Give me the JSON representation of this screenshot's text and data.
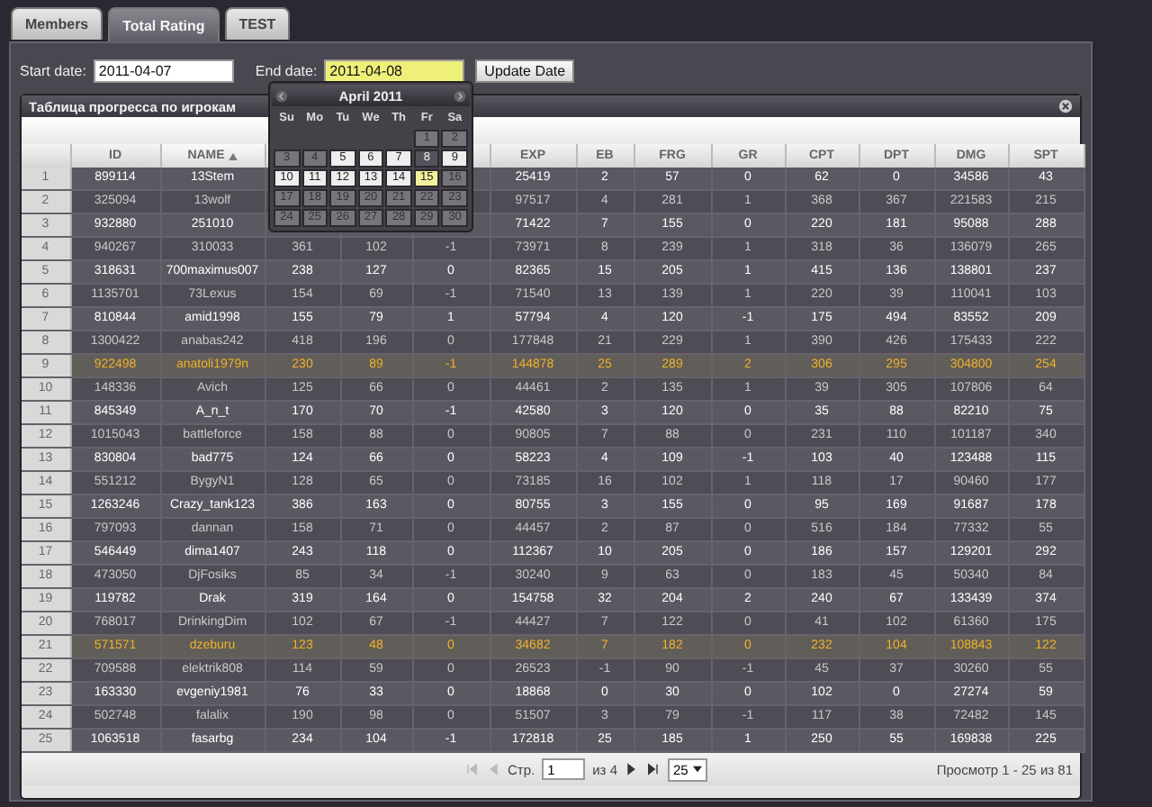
{
  "tabs": [
    {
      "label": "Members",
      "selected": false
    },
    {
      "label": "Total Rating",
      "selected": true
    },
    {
      "label": "TEST",
      "selected": false
    }
  ],
  "filters": [
    {
      "label": "Start date:",
      "value": "2011-04-07",
      "focused": false
    },
    {
      "label": "End date:",
      "value": "2011-04-08",
      "focused": true
    }
  ],
  "update_button": "Update Date",
  "calendar": {
    "title": "April 2011",
    "weekdays": [
      "Su",
      "Mo",
      "Tu",
      "We",
      "Th",
      "Fr",
      "Sa"
    ],
    "days": [
      {
        "day": "1",
        "kind": "disabled"
      },
      {
        "day": "2",
        "kind": "disabled"
      },
      {
        "day": "3",
        "kind": "disabled"
      },
      {
        "day": "4",
        "kind": "disabled"
      },
      {
        "day": "5",
        "kind": "enabled"
      },
      {
        "day": "6",
        "kind": "enabled"
      },
      {
        "day": "7",
        "kind": "enabled"
      },
      {
        "day": "8",
        "kind": "selected"
      },
      {
        "day": "9",
        "kind": "enabled"
      },
      {
        "day": "10",
        "kind": "enabled"
      },
      {
        "day": "11",
        "kind": "enabled"
      },
      {
        "day": "12",
        "kind": "enabled"
      },
      {
        "day": "13",
        "kind": "enabled"
      },
      {
        "day": "14",
        "kind": "enabled"
      },
      {
        "day": "15",
        "kind": "today"
      },
      {
        "day": "16",
        "kind": "disabled"
      },
      {
        "day": "17",
        "kind": "disabled"
      },
      {
        "day": "18",
        "kind": "disabled"
      },
      {
        "day": "19",
        "kind": "disabled"
      },
      {
        "day": "20",
        "kind": "disabled"
      },
      {
        "day": "21",
        "kind": "disabled"
      },
      {
        "day": "22",
        "kind": "disabled"
      },
      {
        "day": "23",
        "kind": "disabled"
      },
      {
        "day": "24",
        "kind": "disabled"
      },
      {
        "day": "25",
        "kind": "disabled"
      },
      {
        "day": "26",
        "kind": "disabled"
      },
      {
        "day": "27",
        "kind": "disabled"
      },
      {
        "day": "28",
        "kind": "disabled"
      },
      {
        "day": "29",
        "kind": "disabled"
      },
      {
        "day": "30",
        "kind": "disabled"
      }
    ]
  },
  "panel": {
    "title": "Таблица прогресса по игрокам",
    "columns": [
      null,
      {
        "label": "ID",
        "sorted": false
      },
      {
        "label": "NAME",
        "sorted": true
      },
      null,
      null,
      null,
      {
        "label": "EXP",
        "sorted": false
      },
      {
        "label": "EB",
        "sorted": false
      },
      {
        "label": "FRG",
        "sorted": false
      },
      {
        "label": "GR",
        "sorted": false
      },
      {
        "label": "CPT",
        "sorted": false
      },
      {
        "label": "DPT",
        "sorted": false
      },
      {
        "label": "DMG",
        "sorted": false
      },
      {
        "label": "SPT",
        "sorted": false
      }
    ],
    "rows": [
      {
        "highlighted": false,
        "cells": [
          "1",
          "899114",
          "13Stem",
          null,
          null,
          null,
          "25419",
          "2",
          "57",
          "0",
          "62",
          "0",
          "34586",
          "43"
        ]
      },
      {
        "highlighted": false,
        "cells": [
          "2",
          "325094",
          "13wolf",
          null,
          null,
          null,
          "97517",
          "4",
          "281",
          "1",
          "368",
          "367",
          "221583",
          "215"
        ]
      },
      {
        "highlighted": false,
        "cells": [
          "3",
          "932880",
          "251010",
          null,
          null,
          null,
          "71422",
          "7",
          "155",
          "0",
          "220",
          "181",
          "95088",
          "288"
        ]
      },
      {
        "highlighted": false,
        "cells": [
          "4",
          "940267",
          "310033",
          "361",
          "102",
          "-1",
          "73971",
          "8",
          "239",
          "1",
          "318",
          "36",
          "136079",
          "265"
        ]
      },
      {
        "highlighted": false,
        "cells": [
          "5",
          "318631",
          "700maximus007",
          "238",
          "127",
          "0",
          "82365",
          "15",
          "205",
          "1",
          "415",
          "136",
          "138801",
          "237"
        ]
      },
      {
        "highlighted": false,
        "cells": [
          "6",
          "1135701",
          "73Lexus",
          "154",
          "69",
          "-1",
          "71540",
          "13",
          "139",
          "1",
          "220",
          "39",
          "110041",
          "103"
        ]
      },
      {
        "highlighted": false,
        "cells": [
          "7",
          "810844",
          "amid1998",
          "155",
          "79",
          "1",
          "57794",
          "4",
          "120",
          "-1",
          "175",
          "494",
          "83552",
          "209"
        ]
      },
      {
        "highlighted": false,
        "cells": [
          "8",
          "1300422",
          "anabas242",
          "418",
          "196",
          "0",
          "177848",
          "21",
          "229",
          "1",
          "390",
          "426",
          "175433",
          "222"
        ]
      },
      {
        "highlighted": true,
        "cells": [
          "9",
          "922498",
          "anatoli1979n",
          "230",
          "89",
          "-1",
          "144878",
          "25",
          "289",
          "2",
          "306",
          "295",
          "304800",
          "254"
        ]
      },
      {
        "highlighted": false,
        "cells": [
          "10",
          "148336",
          "Avich",
          "125",
          "66",
          "0",
          "44461",
          "2",
          "135",
          "1",
          "39",
          "305",
          "107806",
          "64"
        ]
      },
      {
        "highlighted": false,
        "cells": [
          "11",
          "845349",
          "A_n_t",
          "170",
          "70",
          "-1",
          "42580",
          "3",
          "120",
          "0",
          "35",
          "88",
          "82210",
          "75"
        ]
      },
      {
        "highlighted": false,
        "cells": [
          "12",
          "1015043",
          "battleforce",
          "158",
          "88",
          "0",
          "90805",
          "7",
          "88",
          "0",
          "231",
          "110",
          "101187",
          "340"
        ]
      },
      {
        "highlighted": false,
        "cells": [
          "13",
          "830804",
          "bad775",
          "124",
          "66",
          "0",
          "58223",
          "4",
          "109",
          "-1",
          "103",
          "40",
          "123488",
          "115"
        ]
      },
      {
        "highlighted": false,
        "cells": [
          "14",
          "551212",
          "BygyN1",
          "128",
          "65",
          "0",
          "73185",
          "16",
          "102",
          "1",
          "118",
          "17",
          "90460",
          "177"
        ]
      },
      {
        "highlighted": false,
        "cells": [
          "15",
          "1263246",
          "Crazy_tank123",
          "386",
          "163",
          "0",
          "80755",
          "3",
          "155",
          "0",
          "95",
          "169",
          "91687",
          "178"
        ]
      },
      {
        "highlighted": false,
        "cells": [
          "16",
          "797093",
          "dannan",
          "158",
          "71",
          "0",
          "44457",
          "2",
          "87",
          "0",
          "516",
          "184",
          "77332",
          "55"
        ]
      },
      {
        "highlighted": false,
        "cells": [
          "17",
          "546449",
          "dima1407",
          "243",
          "118",
          "0",
          "112367",
          "10",
          "205",
          "0",
          "186",
          "157",
          "129201",
          "292"
        ]
      },
      {
        "highlighted": false,
        "cells": [
          "18",
          "473050",
          "DjFosiks",
          "85",
          "34",
          "-1",
          "30240",
          "9",
          "63",
          "0",
          "183",
          "45",
          "50340",
          "84"
        ]
      },
      {
        "highlighted": false,
        "cells": [
          "19",
          "119782",
          "Drak",
          "319",
          "164",
          "0",
          "154758",
          "32",
          "204",
          "2",
          "240",
          "67",
          "133439",
          "374"
        ]
      },
      {
        "highlighted": false,
        "cells": [
          "20",
          "768017",
          "DrinkingDim",
          "102",
          "67",
          "-1",
          "44427",
          "7",
          "122",
          "0",
          "41",
          "102",
          "61360",
          "175"
        ]
      },
      {
        "highlighted": true,
        "cells": [
          "21",
          "571571",
          "dzeburu",
          "123",
          "48",
          "0",
          "34682",
          "7",
          "182",
          "0",
          "232",
          "104",
          "108843",
          "122"
        ]
      },
      {
        "highlighted": false,
        "cells": [
          "22",
          "709588",
          "elektrik808",
          "114",
          "59",
          "0",
          "26523",
          "-1",
          "90",
          "-1",
          "45",
          "37",
          "30260",
          "55"
        ]
      },
      {
        "highlighted": false,
        "cells": [
          "23",
          "163330",
          "evgeniy1981",
          "76",
          "33",
          "0",
          "18868",
          "0",
          "30",
          "0",
          "102",
          "0",
          "27274",
          "59"
        ]
      },
      {
        "highlighted": false,
        "cells": [
          "24",
          "502748",
          "falalix",
          "190",
          "98",
          "0",
          "51507",
          "3",
          "79",
          "-1",
          "117",
          "38",
          "72482",
          "145"
        ]
      },
      {
        "highlighted": false,
        "cells": [
          "25",
          "1063518",
          "fasarbg",
          "234",
          "104",
          "-1",
          "172818",
          "25",
          "185",
          "1",
          "250",
          "55",
          "169838",
          "225"
        ]
      }
    ]
  },
  "pager": {
    "buttons": [
      {
        "kind": "first",
        "disabled": true
      },
      {
        "kind": "prev",
        "disabled": true
      },
      {
        "kind": "next",
        "disabled": false
      },
      {
        "kind": "last",
        "disabled": false
      }
    ],
    "page_label": "Стр.",
    "page": "1",
    "page_count": "из 4",
    "page_size": "25",
    "summary": "Просмотр 1 - 25 из 81"
  }
}
